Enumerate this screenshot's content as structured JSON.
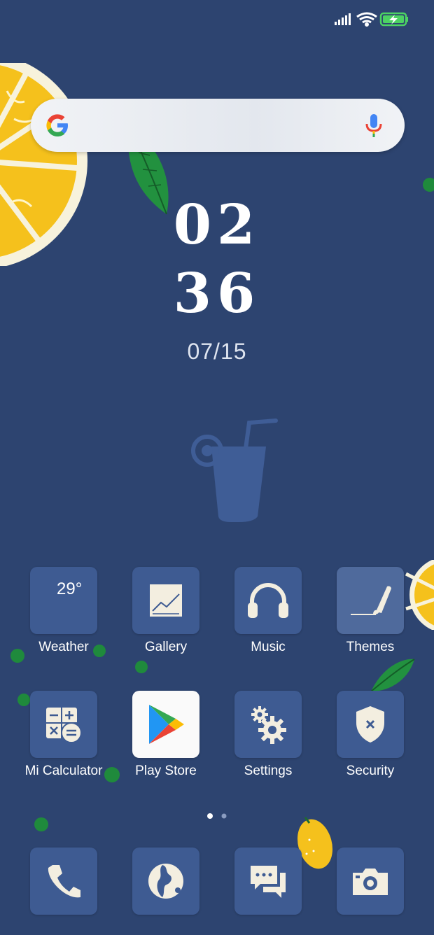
{
  "status_bar": {
    "signal_icon": "signal-bars-icon",
    "wifi_icon": "wifi-icon",
    "battery_icon": "battery-charging-icon"
  },
  "search": {
    "logo_icon": "google-g-icon",
    "mic_icon": "microphone-icon"
  },
  "clock": {
    "hour": "02",
    "minute": "36",
    "date": "07/15"
  },
  "weather": {
    "temperature": "29°"
  },
  "apps": [
    {
      "label": "Weather",
      "icon": "weather-icon"
    },
    {
      "label": "Gallery",
      "icon": "gallery-icon"
    },
    {
      "label": "Music",
      "icon": "headphones-icon"
    },
    {
      "label": "Themes",
      "icon": "paintbrush-icon"
    },
    {
      "label": "Mi Calculator",
      "icon": "calculator-icon"
    },
    {
      "label": "Play Store",
      "icon": "play-store-icon"
    },
    {
      "label": "Settings",
      "icon": "gears-icon"
    },
    {
      "label": "Security",
      "icon": "shield-icon"
    }
  ],
  "dock": [
    {
      "icon": "phone-icon"
    },
    {
      "icon": "browser-icon"
    },
    {
      "icon": "messages-icon"
    },
    {
      "icon": "camera-icon"
    }
  ],
  "page_indicator": {
    "pages": 2,
    "current": 1
  },
  "colors": {
    "background": "#2d4470",
    "tile": "#3e5b92",
    "lemon": "#f5c11c",
    "leaf": "#1f8a3c"
  }
}
